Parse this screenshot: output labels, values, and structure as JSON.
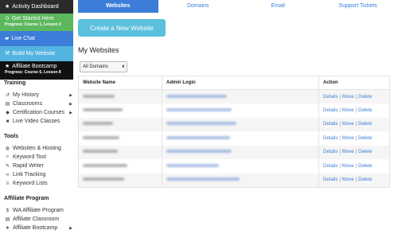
{
  "sidebar": {
    "buttons": {
      "dashboard": "Activity Dashboard",
      "get_started": "Get Started Here",
      "get_started_progress": "Progress: Course 1, Lesson 3",
      "live_chat": "Live Chat",
      "build_website": "Build My Website",
      "affiliate_bootcamp": "Affiliate Bootcamp",
      "bootcamp_progress": "Progress: Course 6, Lesson 8"
    },
    "training": {
      "title": "Training",
      "items": [
        {
          "label": "My History",
          "icon": "history-icon"
        },
        {
          "label": "Classrooms",
          "icon": "book-icon"
        },
        {
          "label": "Certification Courses",
          "icon": "graduation-cap-icon"
        },
        {
          "label": "Live Video Classes",
          "icon": "video-camera-icon"
        }
      ]
    },
    "tools": {
      "title": "Tools",
      "items": [
        {
          "label": "Websites & Hosting",
          "icon": "globe-icon"
        },
        {
          "label": "Keyword Tool",
          "icon": "search-icon"
        },
        {
          "label": "Rapid Writer",
          "icon": "pencil-icon"
        },
        {
          "label": "Link Tracking",
          "icon": "link-icon"
        },
        {
          "label": "Keyword Lists",
          "icon": "list-icon"
        }
      ]
    },
    "affiliate": {
      "title": "Affiliate Program",
      "items": [
        {
          "label": "WA Affiliate Program",
          "icon": "dollar-icon"
        },
        {
          "label": "Affiliate Classroom",
          "icon": "book-icon"
        },
        {
          "label": "Affiliate Bootcamp",
          "icon": "star-icon"
        }
      ]
    }
  },
  "tabs": [
    "Websites",
    "Domains",
    "Email",
    "Support Tickets"
  ],
  "create_button": "Create a New Website",
  "section_title": "My Websites",
  "domain_filter": "All Domains",
  "table": {
    "headers": [
      "Website Name",
      "Admin Login",
      "Action"
    ],
    "actions": [
      "Details",
      "Move",
      "Delete"
    ],
    "row_count": 7
  },
  "colors": {
    "accent": "#3b7dd8",
    "green": "#5cb85c",
    "cyan": "#5bc0de"
  }
}
